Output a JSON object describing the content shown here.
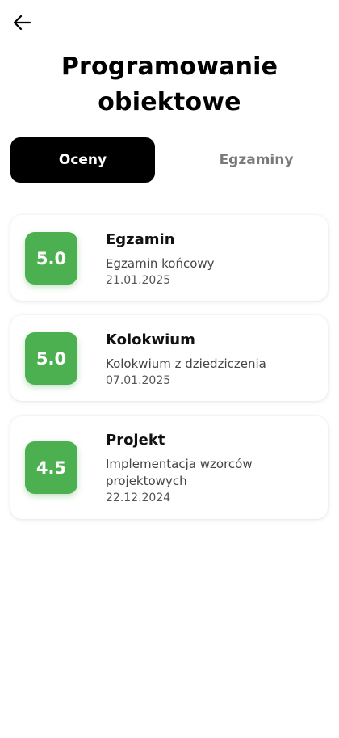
{
  "header": {
    "title_line1": "Programowanie",
    "title_line2": "obiektowe"
  },
  "tabs": [
    {
      "label": "Oceny",
      "active": true
    },
    {
      "label": "Egzaminy",
      "active": false
    }
  ],
  "grades": [
    {
      "value": "5.0",
      "name": "Egzamin",
      "description": "Egzamin końcowy",
      "date": "21.01.2025"
    },
    {
      "value": "5.0",
      "name": "Kolokwium",
      "description": "Kolokwium z dziedziczenia",
      "date": "07.01.2025"
    },
    {
      "value": "4.5",
      "name": "Projekt",
      "description_line1": "Implementacja wzorców",
      "description_line2": "projektowych",
      "date": "22.12.2024"
    }
  ],
  "colors": {
    "grade_badge": "#4caf50",
    "active_tab_bg": "#000000",
    "inactive_tab_text": "#7a7a7a"
  },
  "icons": {
    "back": "arrow-left-icon"
  }
}
